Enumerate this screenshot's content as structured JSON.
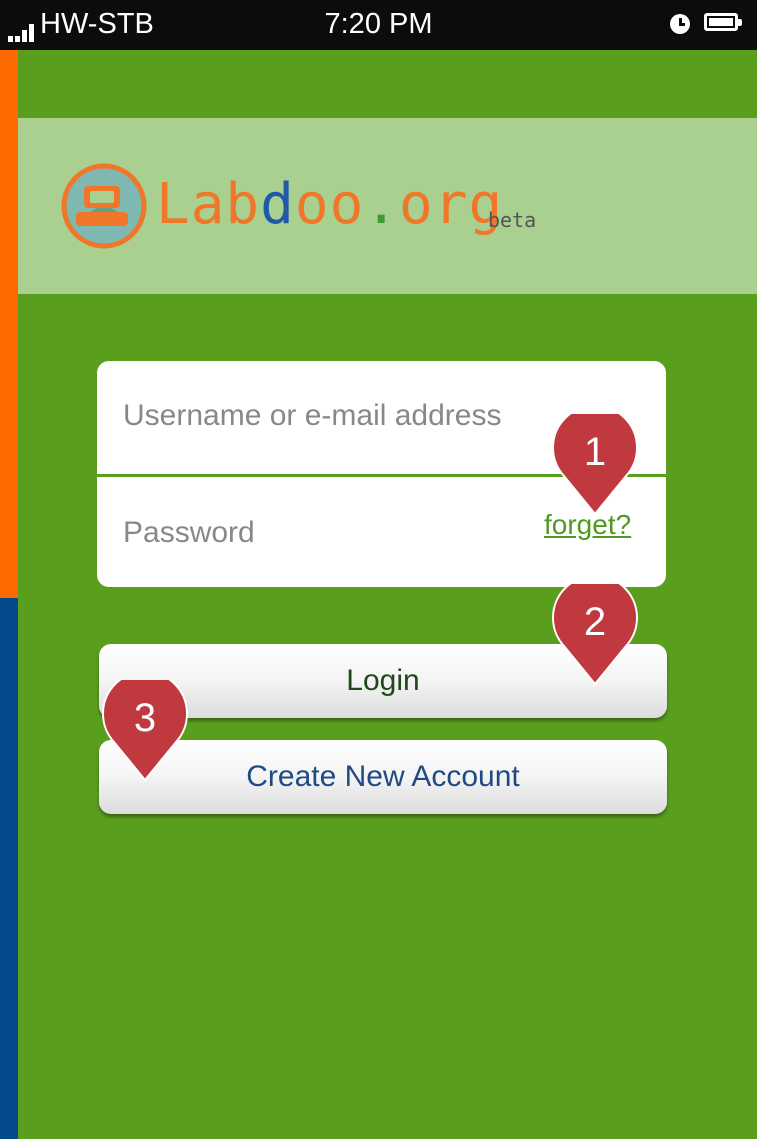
{
  "status_bar": {
    "carrier": "HW-STB",
    "time": "7:20 PM"
  },
  "header": {
    "logo_parts": [
      "Lab",
      "d",
      "oo",
      ".",
      "org"
    ],
    "beta_label": "beta"
  },
  "login": {
    "username_placeholder": "Username or e-mail address",
    "password_placeholder": "Password",
    "forget_link": "forget?"
  },
  "buttons": {
    "login_label": "Login",
    "create_account_label": "Create New Account"
  },
  "markers": [
    "1",
    "2",
    "3"
  ],
  "colors": {
    "background": "#5a9e1e",
    "header_band": "#aad090",
    "stripe_orange": "#ff6a00",
    "stripe_blue": "#034a8a",
    "marker": "#c0393f"
  }
}
